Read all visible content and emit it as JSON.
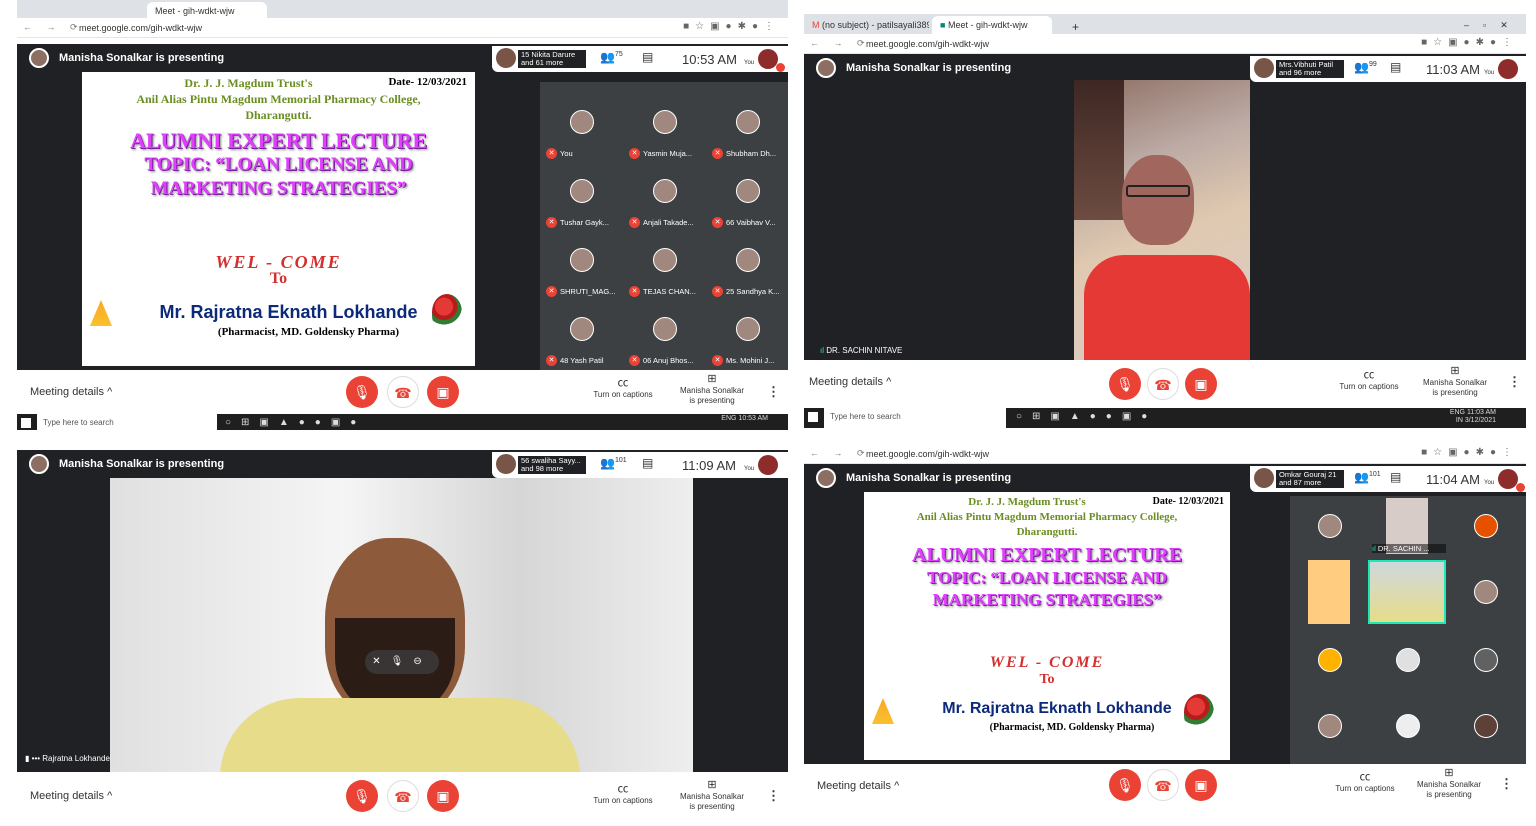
{
  "common": {
    "presenting": "Manisha Sonalkar is presenting",
    "you": "You",
    "meeting_details": "Meeting details",
    "captions": "Turn on captions",
    "presenter_side": "Manisha Sonalkar is presenting",
    "url": "meet.google.com/gih-wdkt-wjw",
    "taskbar_search": "Type here to search",
    "taskbar_lang": "ENG",
    "taskbar_region": "IN",
    "colors": {
      "meet_bg": "#202124",
      "red": "#ea4335",
      "slide_pink": "#e040fb",
      "slide_name": "#0d2a7a"
    }
  },
  "slide": {
    "trust": "Dr. J. J. Magdum Trust's",
    "date": "Date- 12/03/2021",
    "college": "Anil Alias Pintu Magdum Memorial Pharmacy College,",
    "place": "Dharangutti.",
    "line1": "ALUMNI EXPERT LECTURE",
    "line2": "TOPIC: “LOAN LICENSE AND",
    "line3": "MARKETING STRATEGIES”",
    "welcome": "WEL - COME",
    "to": "To",
    "speaker": "Mr. Rajratna Eknath Lokhande",
    "role": "(Pharmacist, MD. Goldensky Pharma)"
  },
  "q1": {
    "tab": "Meet - gih-wdkt-wjw",
    "others": "15 Nikita Darure and 61 more",
    "count": "75",
    "time": "10:53 AM",
    "clock": "10:53 AM",
    "tiles": [
      "You",
      "Yasmin Muja...",
      "Shubham Dh...",
      "Tushar Gayk...",
      "Anjali Takade...",
      "66 Vaibhav V...",
      "SHRUTI_MAG...",
      "TEJAS CHAN...",
      "25 Sandhya K...",
      "48 Yash Patil",
      "06 Anuj Bhos...",
      "Ms. Mohini J..."
    ]
  },
  "q2": {
    "tab1": "(no subject) - patilsayali389@gm",
    "tab2": "Meet - gih-wdkt-wjw",
    "others": "Mrs.Vibhuti Patil and 96 more",
    "count": "99",
    "time": "11:03 AM",
    "speaker": "DR. SACHIN NITAVE",
    "clock": "11:03 AM",
    "date": "3/12/2021"
  },
  "q3": {
    "others": "56 swaliha Sayy... and 98 more",
    "count": "101",
    "time": "11:09 AM",
    "speaker": "Rajratna Lokhande"
  },
  "q4": {
    "others": "Omkar Gouraj 21 and 87 more",
    "count": "101",
    "time": "11:04 AM",
    "tile_speaker": "DR. SACHIN ..."
  }
}
